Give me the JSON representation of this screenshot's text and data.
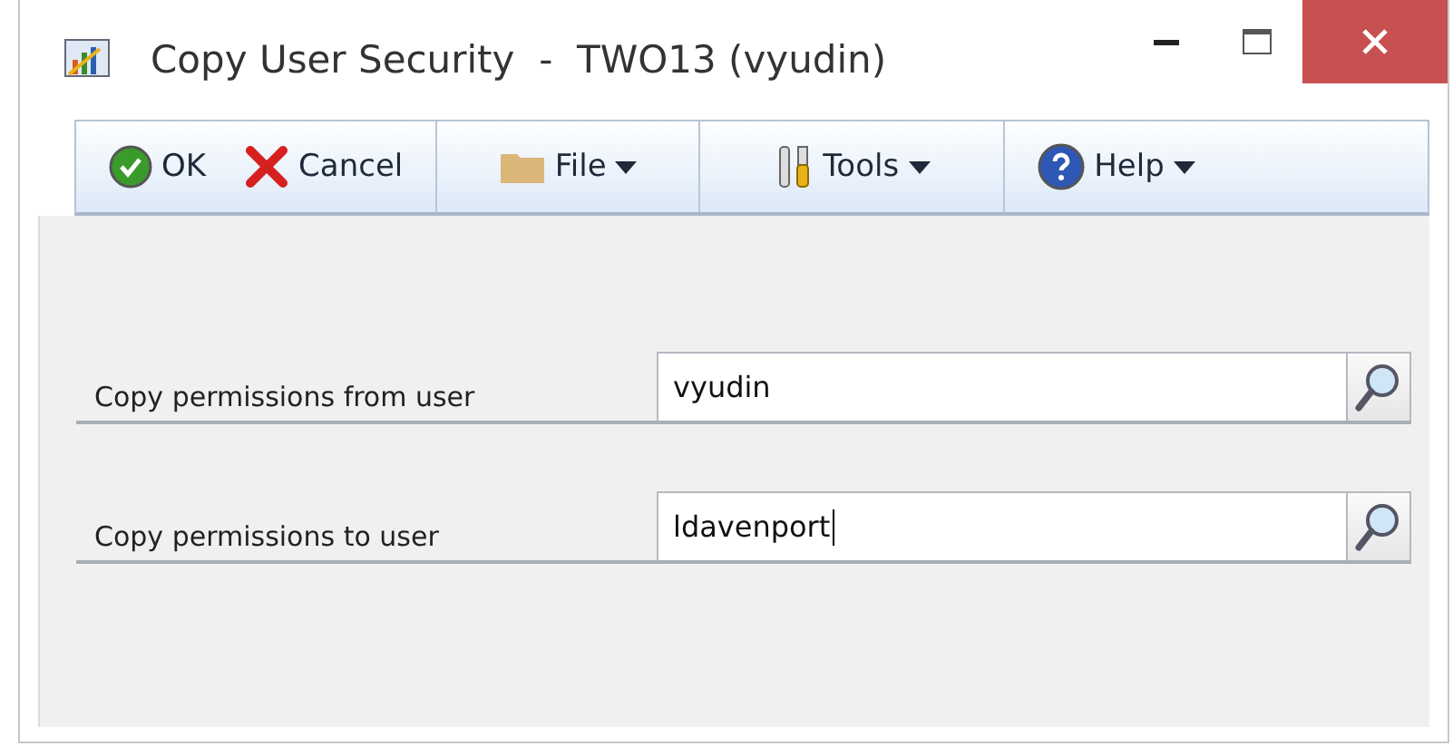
{
  "window": {
    "title": "Copy User Security  -  TWO13 (vyudin)"
  },
  "toolbar": [
    {
      "kind": "ok",
      "label": "OK",
      "dropdown": false
    },
    {
      "kind": "cancel",
      "label": "Cancel",
      "dropdown": false
    },
    {
      "kind": "file",
      "label": "File",
      "dropdown": true
    },
    {
      "kind": "tools",
      "label": "Tools",
      "dropdown": true
    },
    {
      "kind": "help",
      "label": "Help",
      "dropdown": true
    }
  ],
  "fields": [
    {
      "label": "Copy permissions from user",
      "value": "vyudin",
      "focused": false
    },
    {
      "label": "Copy permissions to user",
      "value": "ldavenport",
      "focused": true
    }
  ]
}
